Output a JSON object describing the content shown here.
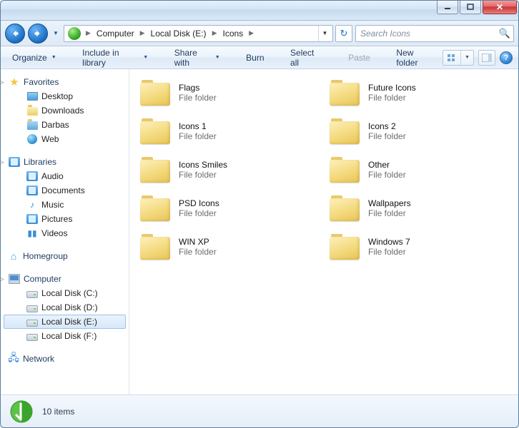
{
  "titlebar": {
    "min": "–",
    "max": "❐",
    "close": "✕"
  },
  "nav": {
    "breadcrumb": [
      "Computer",
      "Local Disk (E:)",
      "Icons"
    ],
    "search_placeholder": "Search Icons"
  },
  "toolbar": {
    "organize": "Organize",
    "include": "Include in library",
    "share": "Share with",
    "burn": "Burn",
    "selectall": "Select all",
    "paste": "Paste",
    "newfolder": "New folder"
  },
  "sidebar": {
    "favorites": {
      "label": "Favorites",
      "items": [
        "Desktop",
        "Downloads",
        "Darbas",
        "Web"
      ]
    },
    "libraries": {
      "label": "Libraries",
      "items": [
        "Audio",
        "Documents",
        "Music",
        "Pictures",
        "Videos"
      ]
    },
    "homegroup": {
      "label": "Homegroup"
    },
    "computer": {
      "label": "Computer",
      "items": [
        "Local Disk (C:)",
        "Local Disk (D:)",
        "Local Disk (E:)",
        "Local Disk (F:)"
      ],
      "selected": 2
    },
    "network": {
      "label": "Network"
    }
  },
  "items": [
    {
      "name": "Flags",
      "type": "File folder"
    },
    {
      "name": "Future Icons",
      "type": "File folder"
    },
    {
      "name": "Icons 1",
      "type": "File folder"
    },
    {
      "name": "Icons 2",
      "type": "File folder"
    },
    {
      "name": "Icons Smiles",
      "type": "File folder"
    },
    {
      "name": "Other",
      "type": "File folder"
    },
    {
      "name": "PSD Icons",
      "type": "File folder"
    },
    {
      "name": "Wallpapers",
      "type": "File folder"
    },
    {
      "name": "WIN XP",
      "type": "File folder"
    },
    {
      "name": "Windows 7",
      "type": "File folder"
    }
  ],
  "status": {
    "count": "10 items"
  }
}
